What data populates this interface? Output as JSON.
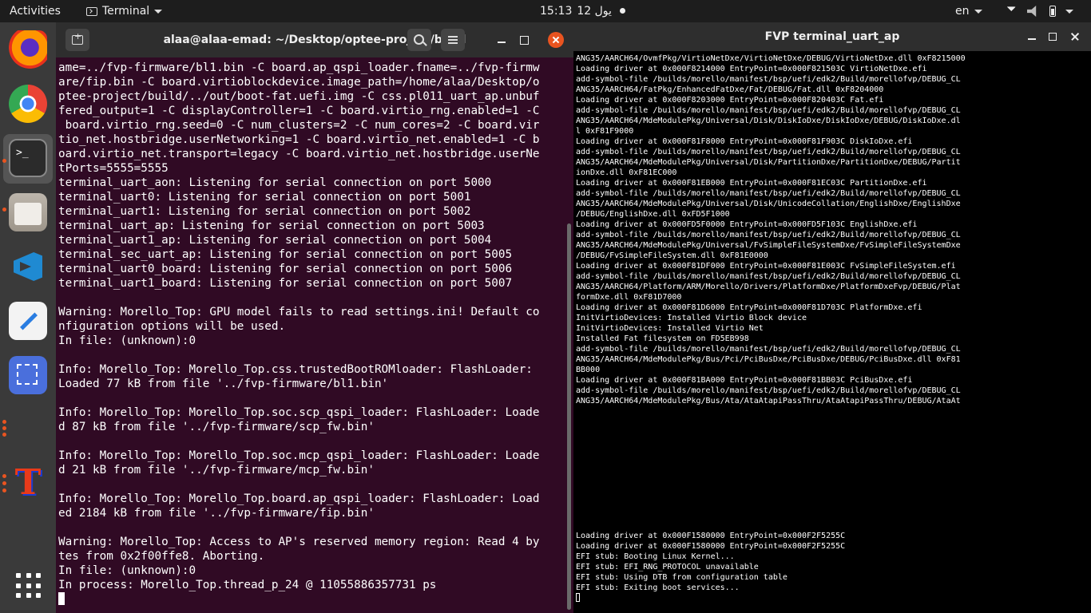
{
  "topbar": {
    "activities": "Activities",
    "app_name": "Terminal",
    "time": "15:13",
    "date": "يول 12",
    "language": "en"
  },
  "dock": {
    "apps": [
      "firefox-icon",
      "chrome-icon",
      "terminal-icon",
      "files-icon",
      "vscode-icon",
      "text-editor-icon",
      "screenshot-icon",
      "texmaker-icon"
    ],
    "terminal_glyph": ">_",
    "texmaker_glyph": "T",
    "accent": "#e95420"
  },
  "terminal": {
    "title": "alaa@alaa-emad: ~/Desktop/optee-project/build",
    "lines": [
      "ame=../fvp-firmware/bl1.bin -C board.ap_qspi_loader.fname=../fvp-firmw",
      "are/fip.bin -C board.virtioblockdevice.image_path=/home/alaa/Desktop/o",
      "ptee-project/build/../out/boot-fat.uefi.img -C css.pl011_uart_ap.unbuf",
      "fered_output=1 -C displayController=1 -C board.virtio_rng.enabled=1 -C",
      " board.virtio_rng.seed=0 -C num_clusters=2 -C num_cores=2 -C board.vir",
      "tio_net.hostbridge.userNetworking=1 -C board.virtio_net.enabled=1 -C b",
      "oard.virtio_net.transport=legacy -C board.virtio_net.hostbridge.userNe",
      "tPorts=5555=5555",
      "terminal_uart_aon: Listening for serial connection on port 5000",
      "terminal_uart0: Listening for serial connection on port 5001",
      "terminal_uart1: Listening for serial connection on port 5002",
      "terminal_uart_ap: Listening for serial connection on port 5003",
      "terminal_uart1_ap: Listening for serial connection on port 5004",
      "terminal_sec_uart_ap: Listening for serial connection on port 5005",
      "terminal_uart0_board: Listening for serial connection on port 5006",
      "terminal_uart1_board: Listening for serial connection on port 5007",
      "",
      "Warning: Morello_Top: GPU model fails to read settings.ini! Default co",
      "nfiguration options will be used.",
      "In file: (unknown):0",
      "",
      "Info: Morello_Top: Morello_Top.css.trustedBootROMloader: FlashLoader:",
      "Loaded 77 kB from file '../fvp-firmware/bl1.bin'",
      "",
      "Info: Morello_Top: Morello_Top.soc.scp_qspi_loader: FlashLoader: Loade",
      "d 87 kB from file '../fvp-firmware/scp_fw.bin'",
      "",
      "Info: Morello_Top: Morello_Top.soc.mcp_qspi_loader: FlashLoader: Loade",
      "d 21 kB from file '../fvp-firmware/mcp_fw.bin'",
      "",
      "Info: Morello_Top: Morello_Top.board.ap_qspi_loader: FlashLoader: Load",
      "ed 2184 kB from file '../fvp-firmware/fip.bin'",
      "",
      "Warning: Morello_Top: Access to AP's reserved memory region: Read 4 by",
      "tes from 0x2f00ffe8. Aborting.",
      "In file: (unknown):0",
      "In process: Morello_Top.thread_p_24 @ 11055886357731 ps"
    ]
  },
  "fvp": {
    "title": "FVP terminal_uart_ap",
    "top_lines": [
      "ANG35/AARCH64/OvmfPkg/VirtioNetDxe/VirtioNetDxe/DEBUG/VirtioNetDxe.dll 0xF8215000",
      "Loading driver at 0x000F8214000 EntryPoint=0x000F821503C VirtioNetDxe.efi",
      "add-symbol-file /builds/morello/manifest/bsp/uefi/edk2/Build/morellofvp/DEBUG_CL",
      "ANG35/AARCH64/FatPkg/EnhancedFatDxe/Fat/DEBUG/Fat.dll 0xF8204000",
      "Loading driver at 0x000F8203000 EntryPoint=0x000F820403C Fat.efi",
      "add-symbol-file /builds/morello/manifest/bsp/uefi/edk2/Build/morellofvp/DEBUG_CL",
      "ANG35/AARCH64/MdeModulePkg/Universal/Disk/DiskIoDxe/DiskIoDxe/DEBUG/DiskIoDxe.dl",
      "l 0xF81F9000",
      "Loading driver at 0x000F81F8000 EntryPoint=0x000F81F903C DiskIoDxe.efi",
      "add-symbol-file /builds/morello/manifest/bsp/uefi/edk2/Build/morellofvp/DEBUG_CL",
      "ANG35/AARCH64/MdeModulePkg/Universal/Disk/PartitionDxe/PartitionDxe/DEBUG/Partit",
      "ionDxe.dll 0xF81EC000",
      "Loading driver at 0x000F81EB000 EntryPoint=0x000F81EC03C PartitionDxe.efi",
      "add-symbol-file /builds/morello/manifest/bsp/uefi/edk2/Build/morellofvp/DEBUG_CL",
      "ANG35/AARCH64/MdeModulePkg/Universal/Disk/UnicodeCollation/EnglishDxe/EnglishDxe",
      "/DEBUG/EnglishDxe.dll 0xFD5F1000",
      "Loading driver at 0x000FD5F0000 EntryPoint=0x000FD5F103C EnglishDxe.efi",
      "add-symbol-file /builds/morello/manifest/bsp/uefi/edk2/Build/morellofvp/DEBUG_CL",
      "ANG35/AARCH64/MdeModulePkg/Universal/FvSimpleFileSystemDxe/FvSimpleFileSystemDxe",
      "/DEBUG/FvSimpleFileSystem.dll 0xF81E0000",
      "Loading driver at 0x000F81DF000 EntryPoint=0x000F81E003C FvSimpleFileSystem.efi",
      "add-symbol-file /builds/morello/manifest/bsp/uefi/edk2/Build/morellofvp/DEBUG_CL",
      "ANG35/AARCH64/Platform/ARM/Morello/Drivers/PlatformDxe/PlatformDxeFvp/DEBUG/Plat",
      "formDxe.dll 0xF81D7000",
      "Loading driver at 0x000F81D6000 EntryPoint=0x000F81D703C PlatformDxe.efi",
      "InitVirtioDevices: Installed Virtio Block device",
      "InitVirtioDevices: Installed Virtio Net",
      "Installed Fat filesystem on FD5EB998",
      "add-symbol-file /builds/morello/manifest/bsp/uefi/edk2/Build/morellofvp/DEBUG_CL",
      "ANG35/AARCH64/MdeModulePkg/Bus/Pci/PciBusDxe/PciBusDxe/DEBUG/PciBusDxe.dll 0xF81",
      "BB000",
      "Loading driver at 0x000F81BA000 EntryPoint=0x000F81BB03C PciBusDxe.efi",
      "add-symbol-file /builds/morello/manifest/bsp/uefi/edk2/Build/morellofvp/DEBUG_CL",
      "ANG35/AARCH64/MdeModulePkg/Bus/Ata/AtaAtapiPassThru/AtaAtapiPassThru/DEBUG/AtaAt"
    ],
    "bottom_lines": [
      "Loading driver at 0x000F1580000 EntryPoint=0x000F2F5255C",
      "Loading driver at 0x000F1580000 EntryPoint=0x000F2F5255C",
      "EFI stub: Booting Linux Kernel...",
      "EFI stub: EFI_RNG_PROTOCOL unavailable",
      "EFI stub: Using DTB from configuration table",
      "EFI stub: Exiting boot services..."
    ]
  }
}
